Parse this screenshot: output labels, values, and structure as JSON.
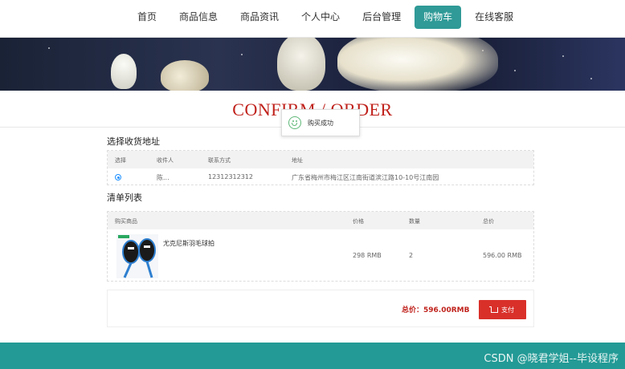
{
  "nav": {
    "items": [
      {
        "label": "首页",
        "active": false
      },
      {
        "label": "商品信息",
        "active": false
      },
      {
        "label": "商品资讯",
        "active": false
      },
      {
        "label": "个人中心",
        "active": false
      },
      {
        "label": "后台管理",
        "active": false
      },
      {
        "label": "购物车",
        "active": true
      },
      {
        "label": "在线客服",
        "active": false
      }
    ]
  },
  "page_title": "CONFIRM / ORDER",
  "toast": {
    "message": "购买成功"
  },
  "address_section": {
    "title": "选择收货地址",
    "headers": [
      "选择",
      "收件人",
      "联系方式",
      "地址"
    ],
    "rows": [
      {
        "selected": true,
        "recipient": "陈...",
        "phone": "12312312312",
        "address": "广东省梅州市梅江区江南街道滨江路10-10号江南园"
      }
    ]
  },
  "items_section": {
    "title": "清单列表",
    "headers": [
      "购买商品",
      "价格",
      "数量",
      "总价"
    ],
    "rows": [
      {
        "name": "尤克尼斯羽毛球拍",
        "price": "298 RMB",
        "quantity": "2",
        "total": "596.00 RMB"
      }
    ]
  },
  "summary": {
    "total_label": "总价：596.00RMB",
    "pay_label": "支付"
  },
  "footer": {
    "watermark": "CSDN @晓君学姐--毕设程序"
  },
  "colors": {
    "accent": "#2f9a97",
    "title_red": "#c0221c",
    "pay_red": "#d9302a",
    "footer": "#239a96"
  }
}
